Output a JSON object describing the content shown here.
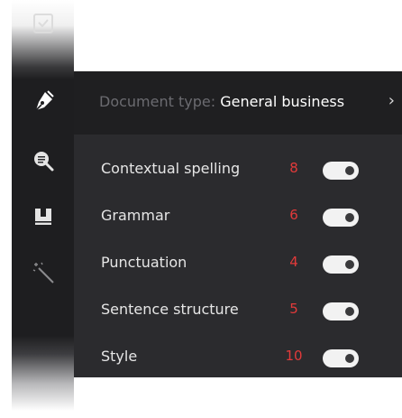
{
  "sidebar": {
    "items": [
      {
        "icon": "inbox-check-icon",
        "active": false
      },
      {
        "icon": "pen-nib-icon",
        "active": true
      },
      {
        "icon": "magnifier-icon",
        "active": false
      },
      {
        "icon": "book-icon",
        "active": false
      },
      {
        "icon": "magic-wand-icon",
        "active": false
      }
    ]
  },
  "header": {
    "label": "Document type: ",
    "value": "General business",
    "chevron": "›"
  },
  "rules": [
    {
      "label": "Contextual spelling",
      "count": "8",
      "enabled": true
    },
    {
      "label": "Grammar",
      "count": "6",
      "enabled": true
    },
    {
      "label": "Punctuation",
      "count": "4",
      "enabled": true
    },
    {
      "label": "Sentence structure",
      "count": "5",
      "enabled": true
    },
    {
      "label": "Style",
      "count": "10",
      "enabled": true
    }
  ],
  "colors": {
    "panel": "#2b2b2e",
    "header": "#1f1f21",
    "count": "#e23a3a",
    "toggle_track": "#f2f2f2"
  }
}
